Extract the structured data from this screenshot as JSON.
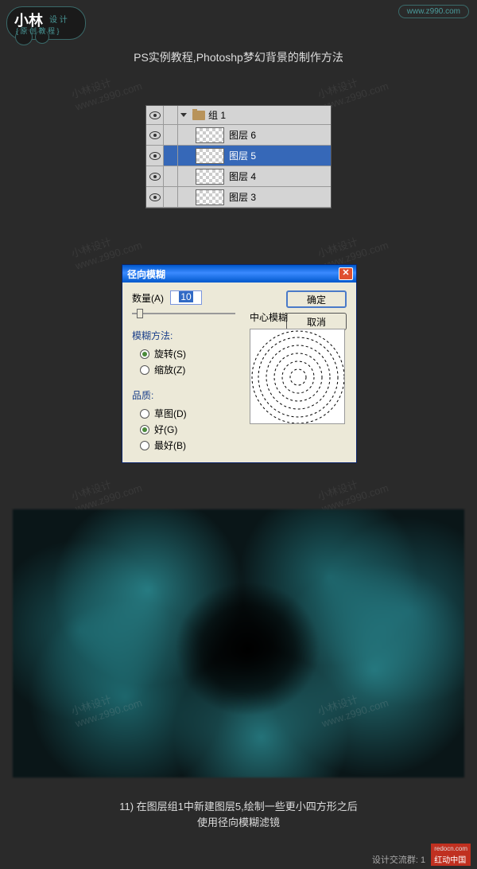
{
  "header": {
    "logo_main": "小林",
    "logo_sub": "设 计",
    "logo_bottom": "{ 原 创 教 程 }",
    "url": "www.z990.com"
  },
  "page_title": "PS实例教程,Photoshp梦幻背景的制作方法",
  "watermark": {
    "line1": "小林设计",
    "line2": "www.z990.com"
  },
  "layers": {
    "group_label": "组 1",
    "items": [
      {
        "name": "图层 6",
        "selected": false
      },
      {
        "name": "图层 5",
        "selected": true
      },
      {
        "name": "图层 4",
        "selected": false
      },
      {
        "name": "图层 3",
        "selected": false
      }
    ]
  },
  "dialog": {
    "title": "径向模糊",
    "amount_label": "数量(A)",
    "amount_value": "10",
    "ok": "确定",
    "cancel": "取消",
    "method_title": "模糊方法:",
    "method_spin": "旋转(S)",
    "method_zoom": "缩放(Z)",
    "quality_title": "品质:",
    "quality_draft": "草图(D)",
    "quality_good": "好(G)",
    "quality_best": "最好(B)",
    "preview_label": "中心模糊"
  },
  "caption": {
    "line1": "11) 在图层组1中新建图层5,绘制一些更小四方形之后",
    "line2": "使用径向模糊滤镜"
  },
  "footer": {
    "text": "设计交流群: 1",
    "badge_url": "redocn.com",
    "badge_text": "红动中国"
  }
}
